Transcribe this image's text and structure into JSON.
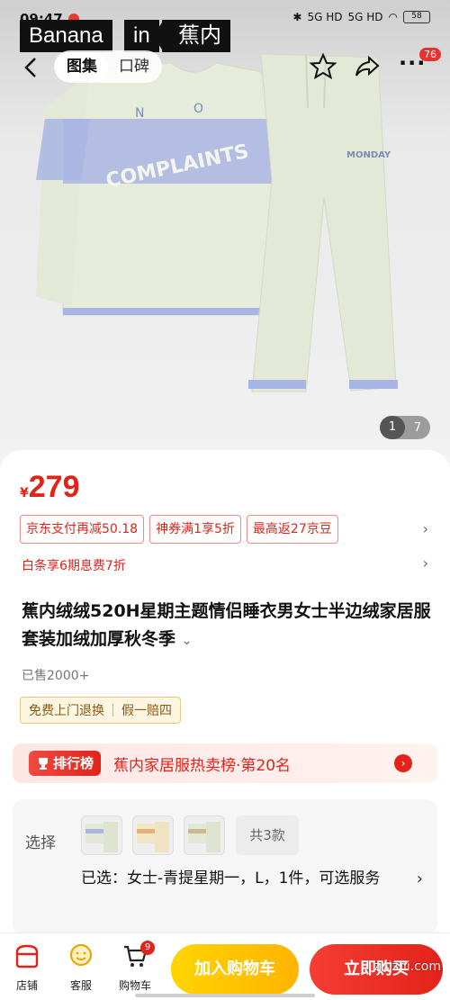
{
  "status_bar": {
    "time": "09:47",
    "signal_1": "5G HD",
    "signal_2": "5G HD",
    "battery": "58"
  },
  "brand": {
    "part1": "Banana",
    "part2": "in",
    "part3": "蕉内"
  },
  "nav": {
    "tabs": [
      "图集",
      "口碑"
    ],
    "more_badge": "76"
  },
  "image_counter": {
    "current": "1",
    "total": "7"
  },
  "price": {
    "currency": "¥",
    "value": "279"
  },
  "promotions": [
    "京东支付再减50.18",
    "神券满1享5折",
    "最高返27京豆"
  ],
  "installment": "白条享6期息费7折",
  "product": {
    "title": "蕉内绒绒520H星期主题情侣睡衣男女士半边绒家居服套装加绒加厚秋冬季",
    "sold": "已售2000+"
  },
  "services": [
    "免费上门退换",
    "假一赔四"
  ],
  "ranking": {
    "badge": "排行榜",
    "text": "蕉内家居服热卖榜·第20名"
  },
  "selection": {
    "label": "选择",
    "count": "共3款",
    "selected": "已选：女士-青提星期一，L，1件，可选服务"
  },
  "bottom_bar": {
    "shop": "店铺",
    "service": "客服",
    "cart": "购物车",
    "cart_count": "9",
    "add_to_cart": "加入购物车",
    "buy_now": "立即购买"
  },
  "watermark": "zhizhi.com",
  "colors": {
    "price_red": "#e2231a",
    "cart_yellow": "#ffc400",
    "sweater_green": "#e4ead8",
    "stripe_lavender": "#9eaee0"
  }
}
